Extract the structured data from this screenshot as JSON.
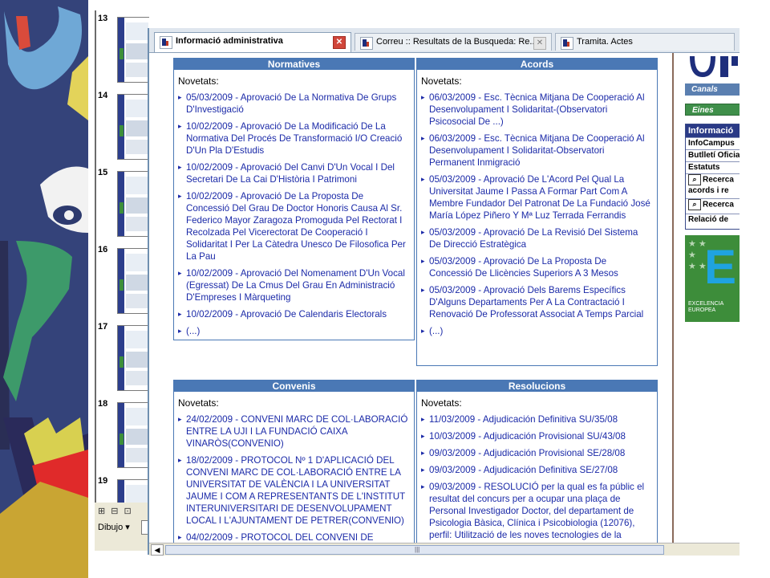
{
  "slides": [
    {
      "number": "13"
    },
    {
      "number": "14"
    },
    {
      "number": "15"
    },
    {
      "number": "16"
    },
    {
      "number": "17"
    },
    {
      "number": "18"
    },
    {
      "number": "19"
    }
  ],
  "ppt_toolbar": {
    "view_icons": "⊞ ⊟ ⊡",
    "draw_menu": "Dibujo ▾"
  },
  "tabs": [
    {
      "label": "Informació administrativa",
      "close": "✕"
    },
    {
      "label": "Correu :: Resultats de la Busqueda: Re...",
      "close": "✕"
    },
    {
      "label": "Tramita. Actes",
      "close": ""
    }
  ],
  "panels": {
    "normatives": {
      "title": "Normatives",
      "intro": "Novetats:",
      "items": [
        "05/03/2009 - Aprovació De La Normativa De Grups D'Investigació",
        "10/02/2009 - Aprovació De La Modificació De La Normativa Del Procés De Transformació I/O Creació D'Un Pla D'Estudis",
        "10/02/2009 - Aprovació Del Canvi D'Un Vocal I Del Secretari De La Cai D'Història I Patrimoni",
        "10/02/2009 - Aprovació De La Proposta De Concessió Del Grau De Doctor Honoris Causa Al Sr. Federico Mayor Zaragoza Promoguda Pel Rectorat I Recolzada Pel Vicerectorat De Cooperació I Solidaritat I Per La Càtedra Unesco De Filosofica Per La Pau",
        "10/02/2009 - Aprovació Del Nomenament D'Un Vocal (Egressat) De La Cmus Del Grau En Administració D'Empreses I Màrqueting",
        "10/02/2009 - Aprovació De Calendaris Electorals",
        "(...)"
      ]
    },
    "acords": {
      "title": "Acords",
      "intro": "Novetats:",
      "items": [
        "06/03/2009 - Esc. Tècnica Mitjana De Cooperació Al Desenvolupament I Solidaritat-(Observatori Psicosocial De ...)",
        "06/03/2009 - Esc. Tècnica Mitjana De Cooperació Al Desenvolupament I Solidaritat-Observatori Permanent Inmigració",
        "05/03/2009 - Aprovació De L'Acord Pel Qual La Universitat Jaume I Passa A Formar Part Com A Membre Fundador Del Patronat De La Fundació José María López Piñero Y Mª Luz Terrada Ferrandis",
        "05/03/2009 - Aprovació De La Revisió Del Sistema De Direcció Estratègica",
        "05/03/2009 - Aprovació De La Proposta De Concessió De Llicències Superiors A 3 Mesos",
        "05/03/2009 - Aprovació Dels Barems Específics D'Alguns Departaments Per A La Contractació I Renovació De Professorat Associat A Temps Parcial",
        "(...)"
      ]
    },
    "convenis": {
      "title": "Convenis",
      "intro": "Novetats:",
      "items": [
        "24/02/2009 - CONVENI MARC DE COL·LABORACIÓ ENTRE LA UJI I LA FUNDACIÓ CAIXA VINARÒS(CONVENIO)",
        "18/02/2009 - PROTOCOL Nº 1 D'APLICACIÓ DEL CONVENI MARC DE COL·LABORACIÓ ENTRE LA UNIVERSITAT DE VALÈNCIA I LA UNIVERSITAT JAUME I COM A REPRESENTANTS DE L'INSTITUT INTERUNIVERSITARI DE DESENVOLUPAMENT LOCAL I L'AJUNTAMENT DE PETRER(CONVENIO)",
        "04/02/2009 - PROTOCOL DEL CONVENI DE"
      ]
    },
    "resolucions": {
      "title": "Resolucions",
      "intro": "Novetats:",
      "items": [
        "11/03/2009 - Adjudicación Definitiva SU/35/08",
        "10/03/2009 - Adjudicación Provisional SU/43/08",
        "09/03/2009 - Adjudicación Provisional SE/28/08",
        "09/03/2009 - Adjudicación Definitiva SE/27/08",
        "09/03/2009 - RESOLUCIÓ per la qual es fa públic el resultat del concurs per a ocupar una plaça de Personal Investigador Doctor, del departament de Psicologia Bàsica, Clínica i Psicobiologia (12076), perfil: Utilització de les noves tecnologies de la"
      ]
    }
  },
  "sidebar": {
    "canals": "Canals",
    "eines": "Eines",
    "info_header": "Informació",
    "items": [
      "InfoCampus",
      "Butlletí Oficial",
      "Estatuts"
    ],
    "search1": "Recerca acords i re",
    "search2": "Recerca",
    "relacio": "Relació de",
    "euro_small": "EXCELENCIA EUROPEA"
  },
  "colors": {
    "panel_header": "#4a78b5",
    "link": "#1b2aa8",
    "info_header": "#2a3a86"
  }
}
